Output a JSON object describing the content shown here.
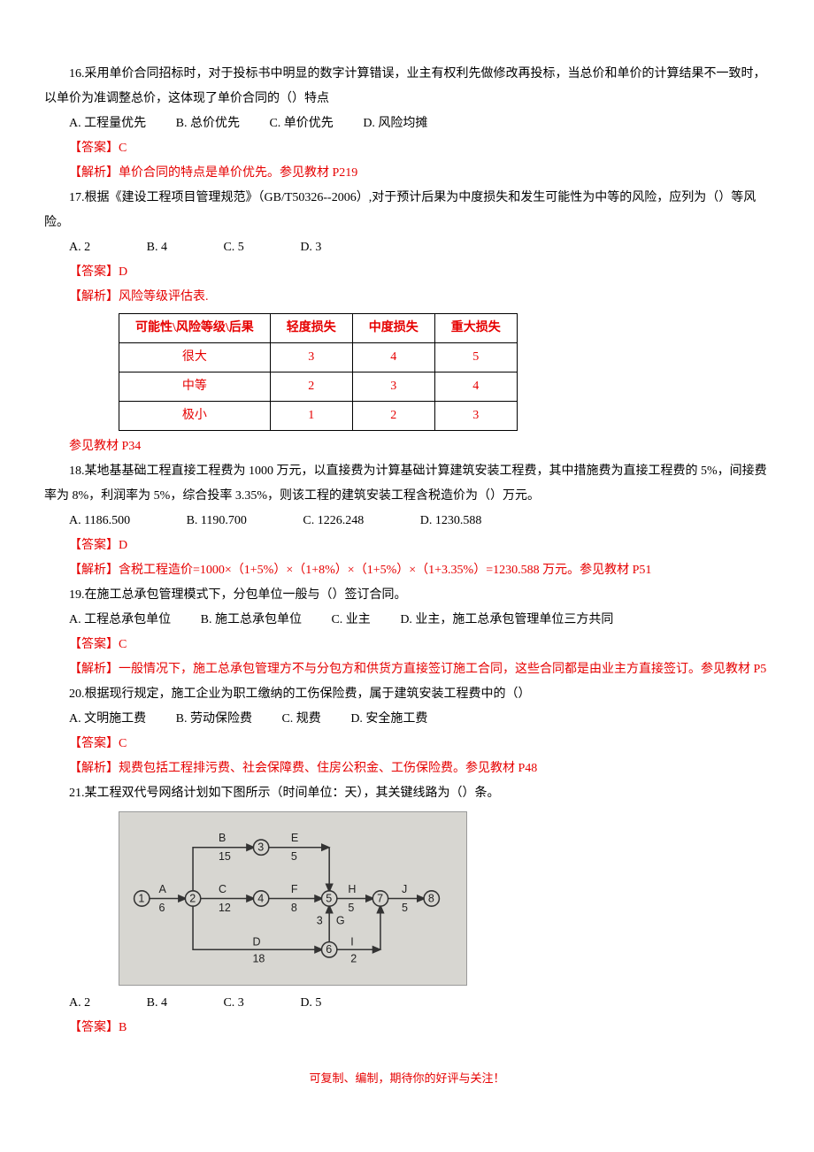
{
  "q16": {
    "text": "16.采用单价合同招标时，对于投标书中明显的数字计算错误，业主有权利先做修改再投标，当总价和单价的计算结果不一致时，以单价为准调整总价，这体现了单价合同的（）特点",
    "optA": "A.    工程量优先",
    "optB": "B.    总价优先",
    "optC": "C.    单价优先",
    "optD": "D.    风险均摊",
    "ans": "【答案】C",
    "exp": "【解析】单价合同的特点是单价优先。参见教材 P219"
  },
  "q17": {
    "text": "17.根据《建设工程项目管理规范》（GB/T50326--2006）,对于预计后果为中度损失和发生可能性为中等的风险，应列为（）等风险。",
    "optA": "A. 2",
    "optB": "B. 4",
    "optC": "C. 5",
    "optD": "D. 3",
    "ans": "【答案】D",
    "exp": "【解析】风险等级评估表.",
    "table": {
      "h1": "可能性\\风险等级\\后果",
      "h2": "轻度损失",
      "h3": "中度损失",
      "h4": "重大损失",
      "r1": {
        "c1": "很大",
        "c2": "3",
        "c3": "4",
        "c4": "5"
      },
      "r2": {
        "c1": "中等",
        "c2": "2",
        "c3": "3",
        "c4": "4"
      },
      "r3": {
        "c1": "极小",
        "c2": "1",
        "c3": "2",
        "c4": "3"
      }
    },
    "ref": "参见教材 P34"
  },
  "q18": {
    "text": "18.某地基基础工程直接工程费为 1000 万元，以直接费为计算基础计算建筑安装工程费，其中措施费为直接工程费的 5%，间接费率为 8%，利润率为 5%，综合投率 3.35%，则该工程的建筑安装工程含税造价为（）万元。",
    "optA": "A. 1186.500",
    "optB": "B. 1190.700",
    "optC": "C. 1226.248",
    "optD": "D. 1230.588",
    "ans": "【答案】D",
    "exp": "【解析】含税工程造价=1000×（1+5%）×（1+8%）×（1+5%）×（1+3.35%）=1230.588 万元。参见教材 P51"
  },
  "q19": {
    "text": "19.在施工总承包管理模式下，分包单位一般与（）签订合同。",
    "optA": "A.    工程总承包单位",
    "optB": "B.    施工总承包单位",
    "optC": "C.    业主",
    "optD": "D.    业主，施工总承包管理单位三方共同",
    "ans": "【答案】C",
    "exp": "【解析】一般情况下，施工总承包管理方不与分包方和供货方直接签订施工合同，这些合同都是由业主方直接签订。参见教材 P5"
  },
  "q20": {
    "text": "20.根据现行规定，施工企业为职工缴纳的工伤保险费，属于建筑安装工程费中的（）",
    "optA": "A.    文明施工费",
    "optB": "B.    劳动保险费",
    "optC": "C.    规费",
    "optD": "D.    安全施工费",
    "ans": "【答案】C",
    "exp": "【解析】规费包括工程排污费、社会保障费、住房公积金、工伤保险费。参见教材 P48"
  },
  "q21": {
    "text": "21.某工程双代号网络计划如下图所示（时间单位：天），其关键线路为（）条。",
    "diagram": {
      "nodes": [
        "1",
        "2",
        "3",
        "4",
        "5",
        "6",
        "7",
        "8"
      ],
      "edges": {
        "A": "6",
        "B": "15",
        "C": "12",
        "D": "18",
        "E": "5",
        "F": "8",
        "G": "3",
        "H": "5",
        "I": "2",
        "J": "5"
      }
    },
    "optA": "A. 2",
    "optB": "B. 4",
    "optC": "C. 3",
    "optD": "D. 5",
    "ans": "【答案】B"
  },
  "footer": "可复制、编制，期待你的好评与关注！"
}
